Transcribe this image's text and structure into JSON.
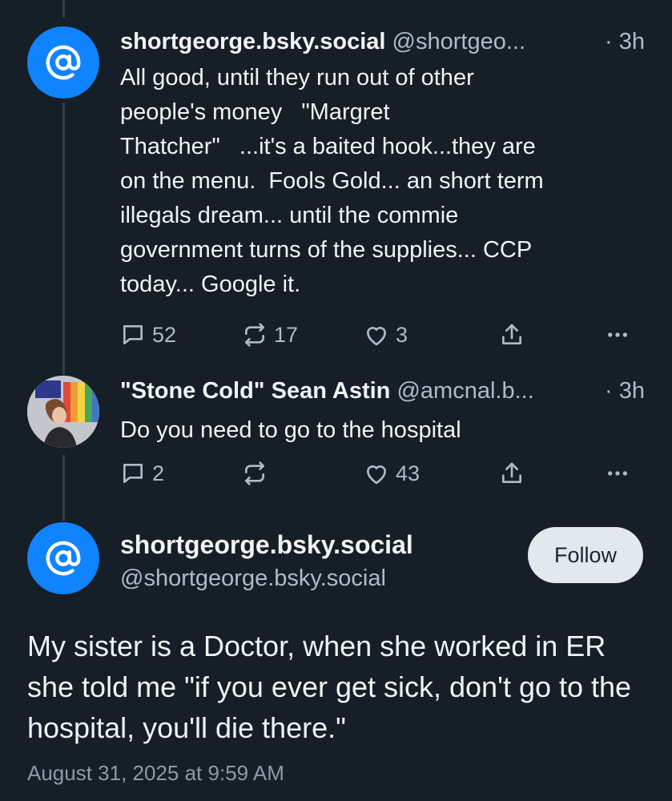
{
  "reply1": {
    "name": "shortgeorge.bsky.social",
    "handle": "@shortgeo...",
    "time": "· 3h",
    "text": "All good, until they run out of other\npeople's money   \"Margret\nThatcher\"   ...it's a baited hook...they are\non the menu.  Fools Gold... an short term\nillegals dream... until the commie\ngovernment turns of the supplies... CCP\ntoday... Google it.",
    "replies": "52",
    "reposts": "17",
    "likes": "3",
    "avatar_icon": "at-sign-icon"
  },
  "reply2": {
    "name": "\"Stone Cold\" Sean Astin",
    "handle": "@amcnal.b...",
    "time": "· 3h",
    "text": "Do you need to go to the hospital",
    "replies": "2",
    "reposts": "",
    "likes": "43"
  },
  "main_post": {
    "name": "shortgeorge.bsky.social",
    "handle": "@shortgeorge.bsky.social",
    "follow_label": "Follow",
    "text": "My sister is a Doctor, when she worked in ER she told me \"if you ever get sick, don't go to the hospital, you'll die there.\"",
    "date": "August 31, 2025 at 9:59 AM",
    "avatar_icon": "at-sign-icon"
  },
  "colors": {
    "background": "#161e27",
    "accent_avatar": "#1083fe",
    "secondary_text": "#aebbc9",
    "follow_button_bg": "#e3e8ed"
  }
}
